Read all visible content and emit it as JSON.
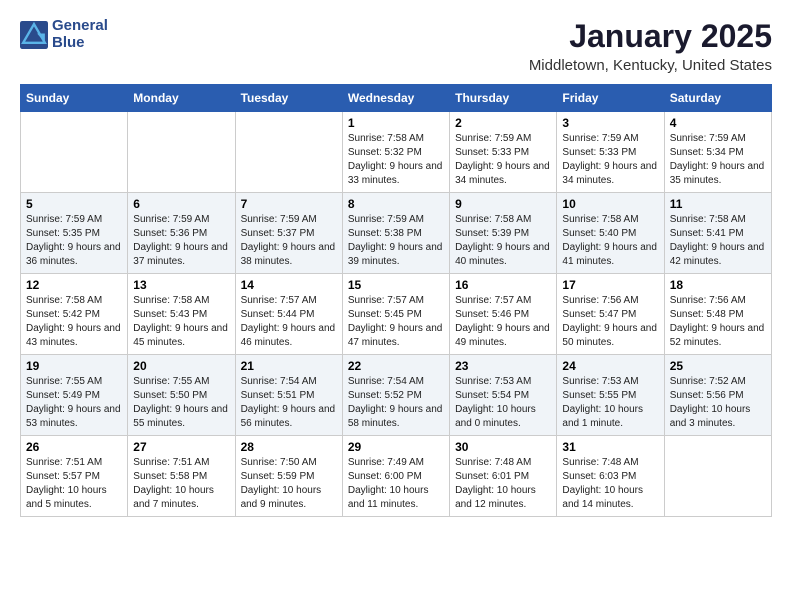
{
  "header": {
    "logo_line1": "General",
    "logo_line2": "Blue",
    "month": "January 2025",
    "location": "Middletown, Kentucky, United States"
  },
  "weekdays": [
    "Sunday",
    "Monday",
    "Tuesday",
    "Wednesday",
    "Thursday",
    "Friday",
    "Saturday"
  ],
  "weeks": [
    [
      {
        "day": "",
        "sunrise": "",
        "sunset": "",
        "daylight": ""
      },
      {
        "day": "",
        "sunrise": "",
        "sunset": "",
        "daylight": ""
      },
      {
        "day": "",
        "sunrise": "",
        "sunset": "",
        "daylight": ""
      },
      {
        "day": "1",
        "sunrise": "Sunrise: 7:58 AM",
        "sunset": "Sunset: 5:32 PM",
        "daylight": "Daylight: 9 hours and 33 minutes."
      },
      {
        "day": "2",
        "sunrise": "Sunrise: 7:59 AM",
        "sunset": "Sunset: 5:33 PM",
        "daylight": "Daylight: 9 hours and 34 minutes."
      },
      {
        "day": "3",
        "sunrise": "Sunrise: 7:59 AM",
        "sunset": "Sunset: 5:33 PM",
        "daylight": "Daylight: 9 hours and 34 minutes."
      },
      {
        "day": "4",
        "sunrise": "Sunrise: 7:59 AM",
        "sunset": "Sunset: 5:34 PM",
        "daylight": "Daylight: 9 hours and 35 minutes."
      }
    ],
    [
      {
        "day": "5",
        "sunrise": "Sunrise: 7:59 AM",
        "sunset": "Sunset: 5:35 PM",
        "daylight": "Daylight: 9 hours and 36 minutes."
      },
      {
        "day": "6",
        "sunrise": "Sunrise: 7:59 AM",
        "sunset": "Sunset: 5:36 PM",
        "daylight": "Daylight: 9 hours and 37 minutes."
      },
      {
        "day": "7",
        "sunrise": "Sunrise: 7:59 AM",
        "sunset": "Sunset: 5:37 PM",
        "daylight": "Daylight: 9 hours and 38 minutes."
      },
      {
        "day": "8",
        "sunrise": "Sunrise: 7:59 AM",
        "sunset": "Sunset: 5:38 PM",
        "daylight": "Daylight: 9 hours and 39 minutes."
      },
      {
        "day": "9",
        "sunrise": "Sunrise: 7:58 AM",
        "sunset": "Sunset: 5:39 PM",
        "daylight": "Daylight: 9 hours and 40 minutes."
      },
      {
        "day": "10",
        "sunrise": "Sunrise: 7:58 AM",
        "sunset": "Sunset: 5:40 PM",
        "daylight": "Daylight: 9 hours and 41 minutes."
      },
      {
        "day": "11",
        "sunrise": "Sunrise: 7:58 AM",
        "sunset": "Sunset: 5:41 PM",
        "daylight": "Daylight: 9 hours and 42 minutes."
      }
    ],
    [
      {
        "day": "12",
        "sunrise": "Sunrise: 7:58 AM",
        "sunset": "Sunset: 5:42 PM",
        "daylight": "Daylight: 9 hours and 43 minutes."
      },
      {
        "day": "13",
        "sunrise": "Sunrise: 7:58 AM",
        "sunset": "Sunset: 5:43 PM",
        "daylight": "Daylight: 9 hours and 45 minutes."
      },
      {
        "day": "14",
        "sunrise": "Sunrise: 7:57 AM",
        "sunset": "Sunset: 5:44 PM",
        "daylight": "Daylight: 9 hours and 46 minutes."
      },
      {
        "day": "15",
        "sunrise": "Sunrise: 7:57 AM",
        "sunset": "Sunset: 5:45 PM",
        "daylight": "Daylight: 9 hours and 47 minutes."
      },
      {
        "day": "16",
        "sunrise": "Sunrise: 7:57 AM",
        "sunset": "Sunset: 5:46 PM",
        "daylight": "Daylight: 9 hours and 49 minutes."
      },
      {
        "day": "17",
        "sunrise": "Sunrise: 7:56 AM",
        "sunset": "Sunset: 5:47 PM",
        "daylight": "Daylight: 9 hours and 50 minutes."
      },
      {
        "day": "18",
        "sunrise": "Sunrise: 7:56 AM",
        "sunset": "Sunset: 5:48 PM",
        "daylight": "Daylight: 9 hours and 52 minutes."
      }
    ],
    [
      {
        "day": "19",
        "sunrise": "Sunrise: 7:55 AM",
        "sunset": "Sunset: 5:49 PM",
        "daylight": "Daylight: 9 hours and 53 minutes."
      },
      {
        "day": "20",
        "sunrise": "Sunrise: 7:55 AM",
        "sunset": "Sunset: 5:50 PM",
        "daylight": "Daylight: 9 hours and 55 minutes."
      },
      {
        "day": "21",
        "sunrise": "Sunrise: 7:54 AM",
        "sunset": "Sunset: 5:51 PM",
        "daylight": "Daylight: 9 hours and 56 minutes."
      },
      {
        "day": "22",
        "sunrise": "Sunrise: 7:54 AM",
        "sunset": "Sunset: 5:52 PM",
        "daylight": "Daylight: 9 hours and 58 minutes."
      },
      {
        "day": "23",
        "sunrise": "Sunrise: 7:53 AM",
        "sunset": "Sunset: 5:54 PM",
        "daylight": "Daylight: 10 hours and 0 minutes."
      },
      {
        "day": "24",
        "sunrise": "Sunrise: 7:53 AM",
        "sunset": "Sunset: 5:55 PM",
        "daylight": "Daylight: 10 hours and 1 minute."
      },
      {
        "day": "25",
        "sunrise": "Sunrise: 7:52 AM",
        "sunset": "Sunset: 5:56 PM",
        "daylight": "Daylight: 10 hours and 3 minutes."
      }
    ],
    [
      {
        "day": "26",
        "sunrise": "Sunrise: 7:51 AM",
        "sunset": "Sunset: 5:57 PM",
        "daylight": "Daylight: 10 hours and 5 minutes."
      },
      {
        "day": "27",
        "sunrise": "Sunrise: 7:51 AM",
        "sunset": "Sunset: 5:58 PM",
        "daylight": "Daylight: 10 hours and 7 minutes."
      },
      {
        "day": "28",
        "sunrise": "Sunrise: 7:50 AM",
        "sunset": "Sunset: 5:59 PM",
        "daylight": "Daylight: 10 hours and 9 minutes."
      },
      {
        "day": "29",
        "sunrise": "Sunrise: 7:49 AM",
        "sunset": "Sunset: 6:00 PM",
        "daylight": "Daylight: 10 hours and 11 minutes."
      },
      {
        "day": "30",
        "sunrise": "Sunrise: 7:48 AM",
        "sunset": "Sunset: 6:01 PM",
        "daylight": "Daylight: 10 hours and 12 minutes."
      },
      {
        "day": "31",
        "sunrise": "Sunrise: 7:48 AM",
        "sunset": "Sunset: 6:03 PM",
        "daylight": "Daylight: 10 hours and 14 minutes."
      },
      {
        "day": "",
        "sunrise": "",
        "sunset": "",
        "daylight": ""
      }
    ]
  ]
}
